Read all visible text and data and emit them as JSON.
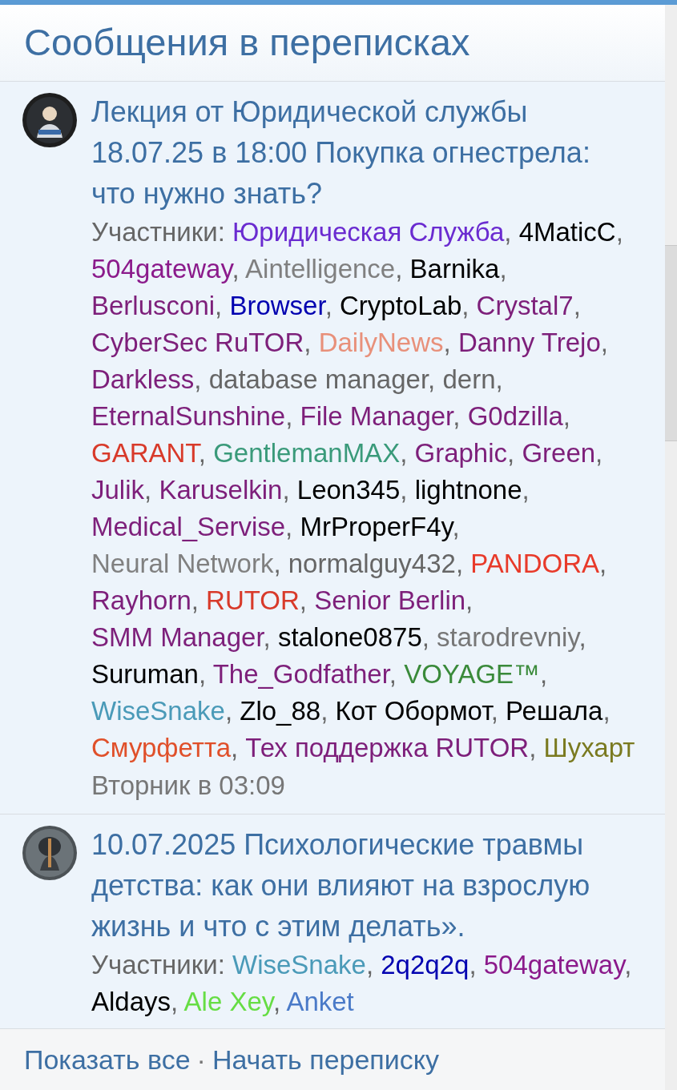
{
  "header": {
    "title": "Сообщения в переписках"
  },
  "conversations": [
    {
      "title": "Лекция от Юридической службы 18.07.25 в 18:00 Покупка огнестрела: что нужно знать?",
      "participants_label": "Участники:",
      "separator": ",",
      "participants": [
        {
          "name": "Юридическая Служба",
          "color": "#6a2bd0"
        },
        {
          "name": "4MaticC",
          "color": "#000000"
        },
        {
          "name": "504gateway",
          "color": "#8b1a8b"
        },
        {
          "name": "Aintelligence",
          "color": "#808080"
        },
        {
          "name": "Barnika",
          "color": "#000000"
        },
        {
          "name": "Berlusconi",
          "color": "#7d1f7a"
        },
        {
          "name": "Browser",
          "color": "#0000b0"
        },
        {
          "name": "CryptoLab",
          "color": "#000000"
        },
        {
          "name": "Crystal7",
          "color": "#7d1f7a"
        },
        {
          "name": "CyberSec RuTOR",
          "color": "#7d1f7a"
        },
        {
          "name": "DailyNews",
          "color": "#e8907a"
        },
        {
          "name": "Danny Trejo",
          "color": "#7d1f7a"
        },
        {
          "name": "Darkless",
          "color": "#7d1f7a"
        },
        {
          "name": "database manager",
          "color": "#666666"
        },
        {
          "name": "dern",
          "color": "#666666"
        },
        {
          "name": "EternalSunshine",
          "color": "#7d1f7a"
        },
        {
          "name": "File Manager",
          "color": "#7d1f7a"
        },
        {
          "name": "G0dzilla",
          "color": "#7d1f7a"
        },
        {
          "name": "GARANT",
          "color": "#d83a2a"
        },
        {
          "name": "GentlemanMAX",
          "color": "#3a9a7a"
        },
        {
          "name": "Graphic",
          "color": "#7d1f7a"
        },
        {
          "name": "Green",
          "color": "#7d1f7a"
        },
        {
          "name": "Julik",
          "color": "#7d1f7a"
        },
        {
          "name": "Karuselkin",
          "color": "#7d1f7a"
        },
        {
          "name": "Leon345",
          "color": "#000000"
        },
        {
          "name": "lightnone",
          "color": "#000000"
        },
        {
          "name": "Medical_Servise",
          "color": "#7d1f7a"
        },
        {
          "name": "MrProperF4y",
          "color": "#000000"
        },
        {
          "name": "Neural Network",
          "color": "#808080"
        },
        {
          "name": "normalguy432",
          "color": "#666666"
        },
        {
          "name": "PANDORA",
          "color": "#e83a2a"
        },
        {
          "name": "Rayhorn",
          "color": "#7d1f7a"
        },
        {
          "name": "RUTOR",
          "color": "#d83a2a"
        },
        {
          "name": "Senior Berlin",
          "color": "#7d1f7a"
        },
        {
          "name": "SMM Manager",
          "color": "#7d1f7a"
        },
        {
          "name": "stalone0875",
          "color": "#000000"
        },
        {
          "name": "starodrevniy",
          "color": "#777777"
        },
        {
          "name": "Suruman",
          "color": "#000000"
        },
        {
          "name": "The_Godfather",
          "color": "#7d1f7a"
        },
        {
          "name": "VOYAGE™",
          "color": "#3a8a3a"
        },
        {
          "name": "WiseSnake",
          "color": "#4a9ab8"
        },
        {
          "name": "Zlo_88",
          "color": "#000000"
        },
        {
          "name": "Кот Обормот",
          "color": "#000000"
        },
        {
          "name": "Решала",
          "color": "#000000"
        },
        {
          "name": "Смурфетта",
          "color": "#e0502a"
        },
        {
          "name": "Тех поддержка RUTOR",
          "color": "#7d1f7a"
        },
        {
          "name": "Шухарт",
          "color": "#7a7a20"
        }
      ],
      "time": "Вторник в 03:09"
    },
    {
      "title": "10.07.2025 Психологические травмы детства: как они влияют на взрослую жизнь и что с этим делать».",
      "participants_label": "Участники:",
      "separator": ",",
      "participants": [
        {
          "name": "WiseSnake",
          "color": "#4a9ab8"
        },
        {
          "name": "2q2q2q",
          "color": "#0000b0"
        },
        {
          "name": "504gateway",
          "color": "#8b1a8b"
        },
        {
          "name": "Aldays",
          "color": "#000000"
        },
        {
          "name": "Ale Xey",
          "color": "#66dd44"
        },
        {
          "name": "Anket",
          "color": "#4a7ac8"
        }
      ]
    }
  ],
  "footer": {
    "links": [
      "Показать все",
      "Начать переписку"
    ],
    "separator": "·"
  }
}
